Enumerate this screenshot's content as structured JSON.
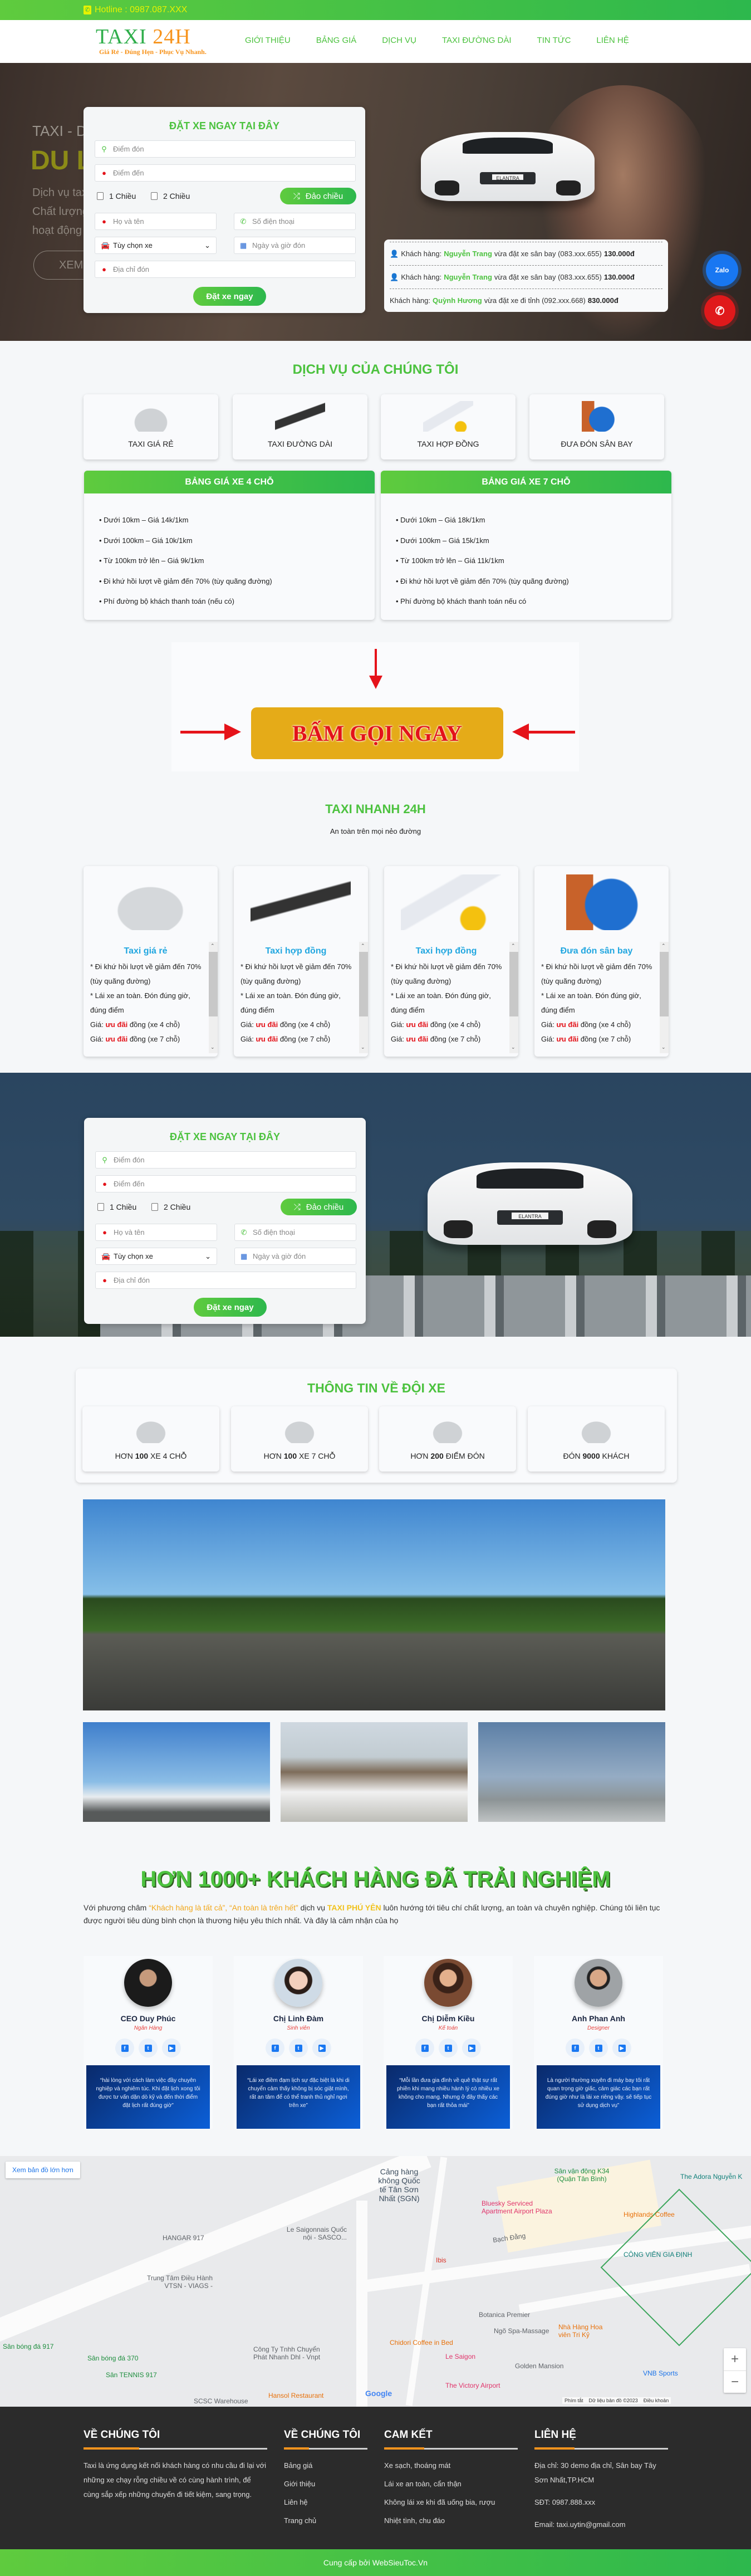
{
  "colors": {
    "brand_green": "#4cc23f",
    "accent_orange": "#f7941d",
    "call_yellow": "#e5ab18",
    "call_red": "#e3131a",
    "service_title_blue": "#22a7e0",
    "footer_bg": "#2b2b2b"
  },
  "topbar": {
    "hotline_icon": "phone-icon",
    "hotline": "Hotline : 0987.087.XXX"
  },
  "header": {
    "logo_main": "TAXI",
    "logo_num": "24H",
    "tagline": "Giá Rẻ - Đúng Hẹn - Phục Vụ Nhanh.",
    "nav": [
      "GIỚI THIỆU",
      "BẢNG GIÁ",
      "DỊCH VỤ",
      "TAXI ĐƯỜNG DÀI",
      "TIN TỨC",
      "LIÊN HỆ"
    ]
  },
  "hero": {
    "kicker": "TAXI - DU",
    "headline": "DU L",
    "desc": [
      "Dịch vụ taxi",
      "Chất lượng",
      "hoạt động 2"
    ],
    "cta": "XEM"
  },
  "booking": {
    "title": "ĐẶT XE NGAY TẠI ĐÂY",
    "pickup_placeholder": "Điểm đón",
    "dest_placeholder": "Điểm đến",
    "one_way": "1 Chiều",
    "two_way": "2 Chiều",
    "swap": "Đảo chiều",
    "name_placeholder": "Họ và tên",
    "phone_placeholder": "Số điện thoại",
    "car_select": "Tùy chọn xe",
    "datetime_placeholder": "Ngày và giờ đón",
    "address_placeholder": "Địa chỉ đón",
    "submit": "Đặt xe ngay"
  },
  "car_plate": "ELANTRA",
  "recent_orders": [
    {
      "prefix": "Khách hàng:",
      "name": "Nguyễn Trang",
      "action": "vừa đặt xe sân bay (083.xxx.655)",
      "price": "130.000đ"
    },
    {
      "prefix": "Khách hàng:",
      "name": "Nguyễn Trang",
      "action": "vừa đặt xe sân bay (083.xxx.655)",
      "price": "130.000đ"
    },
    {
      "prefix": "Khách hàng:",
      "name": "Quỳnh Hương",
      "action": "vừa đặt xe đi tỉnh (092.xxx.668)",
      "price": "830.000đ"
    }
  ],
  "floating": {
    "zalo": "Zalo"
  },
  "services": {
    "title": "DỊCH VỤ CỦA CHÚNG TÔI",
    "items": [
      "TAXI GIÁ RẺ",
      "TAXI ĐƯỜNG DÀI",
      "TAXI HỢP ĐỒNG",
      "ĐƯA ĐÓN SÂN BAY"
    ]
  },
  "prices": [
    {
      "title": "BẢNG GIÁ XE 4 CHỖ",
      "items": [
        "Dưới 10km – Giá 14k/1km",
        "Dưới 100km – Giá 10k/1km",
        "Từ 100km trở lên – Giá 9k/1km",
        "Đi khứ hồi lượt về giảm đến 70% (tùy quãng đường)",
        "Phí đường bộ khách thanh toán (nếu có)"
      ]
    },
    {
      "title": "BẢNG GIÁ XE 7 CHỖ",
      "items": [
        "Dưới 10km – Giá 18k/1km",
        "Dưới 100km – Giá 15k/1km",
        "Từ 100km trở lên – Giá 11k/1km",
        "Đi khứ hồi lượt về giảm đến 70% (tùy quãng đường)",
        "Phí đường bộ khách thanh toán nếu có"
      ]
    }
  ],
  "call_banner": {
    "label": "BẤM GỌI NGAY"
  },
  "fast": {
    "title": "TAXI NHANH 24H",
    "subtitle": "An toàn trên mọi nẻo đường",
    "cards": [
      {
        "title": "Taxi giá rẻ",
        "line1": "* Đi khứ hồi lượt về giảm đến 70% (tùy quãng đường)",
        "line2": "* Lái xe an toàn. Đón đúng giờ, đúng điểm",
        "price_prefix": "Giá:",
        "price_hl": "ưu đãi",
        "price4": "đồng (xe 4 chỗ)",
        "price7": "đồng (xe 7 chỗ)"
      },
      {
        "title": "Taxi hợp đồng",
        "line1": "* Đi khứ hồi lượt về giảm đến 70% (tùy quãng đường)",
        "line2": "* Lái xe an toàn. Đón đúng giờ, đúng điểm",
        "price_prefix": "Giá:",
        "price_hl": "ưu đãi",
        "price4": "đồng (xe 4 chỗ)",
        "price7": "đồng (xe 7 chỗ)"
      },
      {
        "title": "Taxi hợp đồng",
        "line1": "* Đi khứ hồi lượt về giảm đến 70% (tùy quãng đường)",
        "line2": "* Lái xe an toàn. Đón đúng giờ, đúng điểm",
        "price_prefix": "Giá:",
        "price_hl": "ưu đãi",
        "price4": "đồng (xe 4 chỗ)",
        "price7": "đồng (xe 7 chỗ)"
      },
      {
        "title": "Đưa đón sân bay",
        "line1": "* Đi khứ hồi lượt về giảm đến 70% (tùy quãng đường)",
        "line2": "* Lái xe an toàn. Đón đúng giờ, đúng điểm",
        "price_prefix": "Giá:",
        "price_hl": "ưu đãi",
        "price4": "đồng (xe 4 chỗ)",
        "price7": "đồng (xe 7 chỗ)"
      }
    ]
  },
  "fleet": {
    "title": "THÔNG TIN VỀ ĐỘI XE",
    "items": [
      {
        "pre": "HƠN",
        "num": "100",
        "post": "XE 4 CHỖ"
      },
      {
        "pre": "HƠN",
        "num": "100",
        "post": "XE 7 CHỖ"
      },
      {
        "pre": "HƠN",
        "num": "200",
        "post": "ĐIỂM ĐÓN"
      },
      {
        "pre": "ĐÓN",
        "num": "9000",
        "post": "KHÁCH"
      }
    ]
  },
  "testimonials": {
    "title": "HƠN 1000+ KHÁCH HÀNG ĐÃ TRẢI NGHIỆM",
    "intro": {
      "p1": "Với phương châm ",
      "q1": "“Khách hàng là tất cả”, “An toàn là trên hết”",
      "p2": " dịch vụ ",
      "brand": "TAXI PHÚ YÊN",
      "p3": " luôn hướng tới tiêu chí chất lượng, an toàn và chuyên nghiệp. Chúng tôi liên tục được người tiêu dùng bình chọn là thương hiệu yêu thích nhất. Và đây là cảm nhận của họ"
    },
    "items": [
      {
        "name": "CEO Duy Phúc",
        "role": "Ngân Hàng",
        "quote": "“hài lòng với cách làm việc đầy chuyên nghiệp và nghiêm túc. Khi đặt lịch xong tôi được tư vấn dặn dò kỹ và đến thời điểm đặt lịch rất đúng giờ”"
      },
      {
        "name": "Chị Linh Đàm",
        "role": "Sinh viên",
        "quote": "“Lái xe điềm đạm lịch sự đặc biệt là khi di chuyển cảm thấy không bị sóc giật mình, rất an tâm để có thể tranh thủ nghỉ ngơi trên xe”"
      },
      {
        "name": "Chị Diễm Kiều",
        "role": "Kế toán",
        "quote": "“Mỗi lần đưa gia đình về quê thật sự rất phiền khi mang nhiều hành lý có nhiều xe không cho mang. Nhưng ở đây thấy các bạn rất thỏa mái”"
      },
      {
        "name": "Anh Phan Anh",
        "role": "Designer",
        "quote": "Là người thường xuyên đi máy bay tôi rất quan trọng giờ giấc, cảm giác các bạn rất đúng giờ như là lái xe riêng vậy. sẽ tiếp tục sử dụng dịch vụ”"
      }
    ]
  },
  "map": {
    "larger_link": "Xem bản đồ lớn hơn",
    "labels": [
      "HANGAR 917",
      "Trung Tâm Điều Hành VTSN - VIAGS -",
      "Le Saigonnais Quốc nội - SASCO...",
      "Cảng hàng không Quốc tế Tân Sơn Nhất (SGN)",
      "Bluesky Serviced Apartment Airport Plaza",
      "Highlands Coffee",
      "Sân vận động K34 (Quận Tân Bình)",
      "CÔNG VIÊN GIA ĐỊNH",
      "Bạch Đằng",
      "Ibis",
      "Botanica Premier",
      "Ngõ Spa-Massage",
      "Chidori Coffee in Bed",
      "Le Saigon",
      "Golden Mansion",
      "Nhà Hàng Hoa viên Tri Kỷ",
      "Sân bóng đá 917",
      "Sân bóng đá 370",
      "Công Ty Tnhh Chuyển Phát Nhanh Dhl - Vnpt",
      "Sân TENNIS 917",
      "Hansol Restaurant",
      "SCSC Warehouse",
      "The Victory Airport",
      "VNB Sports",
      "The Adora Nguyễn K"
    ],
    "google": "Google",
    "shortcuts": "Phím tắt",
    "data": "Dữ liệu bản đồ ©2023",
    "terms": "Điều khoản",
    "zoom_in": "+",
    "zoom_out": "−"
  },
  "footer": {
    "about_title": "VỀ CHÚNG TÔI",
    "about_text": "Taxi là ứng dụng kết nối khách hàng có nhu cầu đi lại với những xe chạy rỗng chiều về có cùng hành trình, để cùng sắp xếp những chuyến đi tiết kiệm, sang trọng.",
    "links_title": "VỀ CHÚNG TÔI",
    "links": [
      "Bảng giá",
      "Giới thiệu",
      "Liên hệ",
      "Trang chủ"
    ],
    "commit_title": "CAM KẾT",
    "commits": [
      "Xe sạch, thoáng mát",
      "Lái xe an toàn, cẩn thận",
      "Không lái xe khi đã uống bia, rượu",
      "Nhiệt tình, chu đáo"
    ],
    "contact_title": "LIÊN HỆ",
    "address": "Địa chỉ: 30 demo địa chỉ, Sân bay Tây Sơn Nhất,TP.HCM",
    "phone": "SĐT: 0987.888.xxx",
    "email": "Email: taxi.uytin@gmail.com",
    "copyright": "Cung cấp bởi WebSieuToc.Vn"
  }
}
